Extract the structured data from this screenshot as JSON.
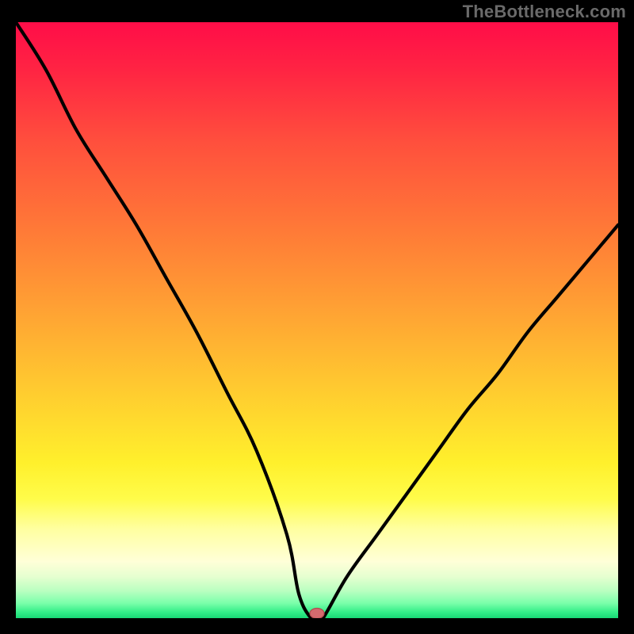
{
  "watermark": "TheBottleneck.com",
  "colors": {
    "background": "#000000",
    "watermark": "#6a6a6a",
    "curve_stroke": "#000000",
    "marker_fill": "#d36a6e",
    "marker_stroke": "#b24a4e"
  },
  "chart_data": {
    "type": "line",
    "title": "",
    "xlabel": "",
    "ylabel": "",
    "ylim": [
      0,
      100
    ],
    "xlim": [
      0,
      100
    ],
    "x": [
      0,
      5,
      10,
      15,
      20,
      25,
      30,
      35,
      40,
      45,
      47,
      49,
      50,
      51,
      55,
      60,
      65,
      70,
      75,
      80,
      85,
      90,
      95,
      100
    ],
    "values": [
      100,
      92,
      82,
      74,
      66,
      57,
      48,
      38,
      28,
      14,
      4,
      0,
      0,
      0,
      7,
      14,
      21,
      28,
      35,
      41,
      48,
      54,
      60,
      66
    ],
    "marker": {
      "x": 50,
      "y": 0
    },
    "gradient_stops": [
      {
        "offset": 0.0,
        "color": "#ff0d48"
      },
      {
        "offset": 0.08,
        "color": "#ff2443"
      },
      {
        "offset": 0.2,
        "color": "#ff4f3d"
      },
      {
        "offset": 0.35,
        "color": "#ff7a37"
      },
      {
        "offset": 0.5,
        "color": "#ffa733"
      },
      {
        "offset": 0.63,
        "color": "#ffcf2f"
      },
      {
        "offset": 0.74,
        "color": "#fff02c"
      },
      {
        "offset": 0.8,
        "color": "#fffc4a"
      },
      {
        "offset": 0.85,
        "color": "#ffffa0"
      },
      {
        "offset": 0.905,
        "color": "#ffffd8"
      },
      {
        "offset": 0.93,
        "color": "#e6ffd0"
      },
      {
        "offset": 0.955,
        "color": "#b8ffc0"
      },
      {
        "offset": 0.975,
        "color": "#7affaa"
      },
      {
        "offset": 0.99,
        "color": "#33ee88"
      },
      {
        "offset": 1.0,
        "color": "#19d876"
      }
    ]
  }
}
